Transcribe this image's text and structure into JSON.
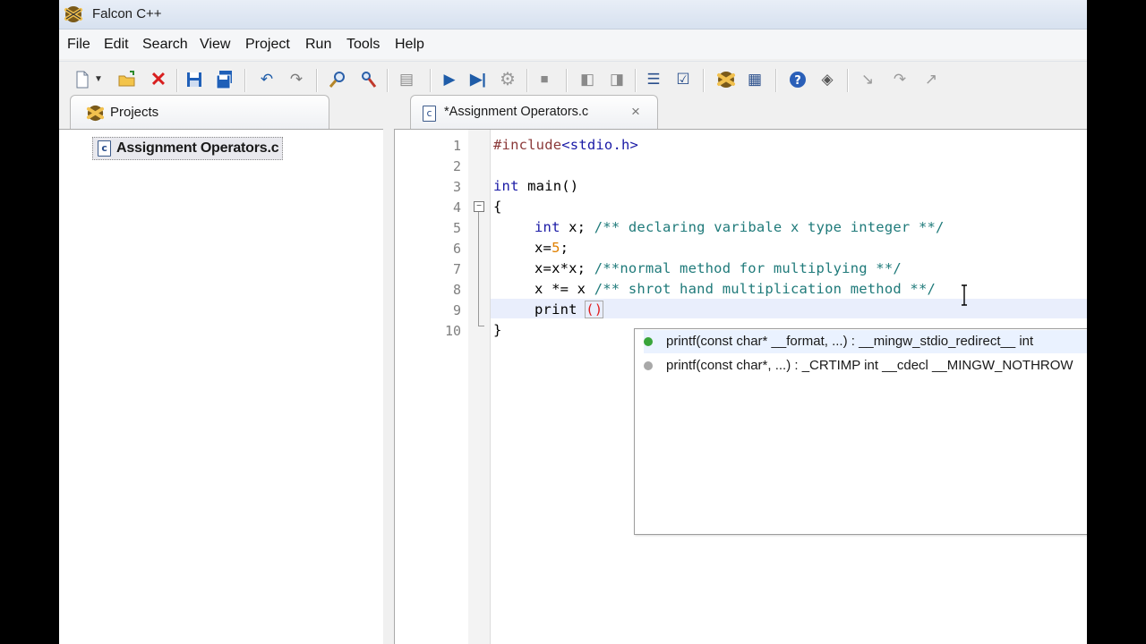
{
  "window": {
    "title": "Falcon C++"
  },
  "menu": [
    "File",
    "Edit",
    "Search",
    "View",
    "Project",
    "Run",
    "Tools",
    "Help"
  ],
  "toolbar": {
    "icons": [
      "new-file-icon",
      "dropdown-arrow-icon",
      "open-folder-icon",
      "close-icon",
      "save-icon",
      "save-all-icon",
      "undo-icon",
      "redo-icon",
      "find-icon",
      "replace-icon",
      "print-icon",
      "run-icon",
      "step-run-icon",
      "build-icon",
      "stop-icon",
      "indent-left-icon",
      "indent-right-icon",
      "list-icon",
      "checkbox-icon",
      "falcon-icon",
      "properties-icon",
      "help-icon",
      "book-icon",
      "step-into-icon",
      "step-over-icon",
      "step-out-icon"
    ]
  },
  "projects_panel": {
    "tab_label": "Projects",
    "items": [
      {
        "label": "Assignment Operators.c"
      }
    ]
  },
  "editor": {
    "tab_label": "*Assignment Operators.c",
    "close_glyph": "×",
    "line_numbers": [
      "1",
      "2",
      "3",
      "4",
      "5",
      "6",
      "7",
      "8",
      "9",
      "10"
    ],
    "lines": {
      "l1_directive": "#include",
      "l1_header": "<stdio.h>",
      "l3_type": "int",
      "l3_rest": " main()",
      "l4": "{",
      "l5_type": "int",
      "l5_var": " x; ",
      "l5_comment": "/** declaring varibale x type integer **/",
      "l6_a": "x=",
      "l6_num": "5",
      "l6_b": ";",
      "l7_code": "x=x*x; ",
      "l7_comment": "/**normal method for multiplying **/",
      "l8_code": "x *= x ",
      "l8_comment": "/** shrot hand multiplication method **/",
      "l9_code": "print ",
      "l9_paren": "()",
      "l10": "}"
    }
  },
  "autocomplete": {
    "items": [
      {
        "text": "printf(const char* __format, ...) : __mingw_stdio_redirect__ int",
        "dot_color": "#3aa53a",
        "selected": true
      },
      {
        "text": "printf(const char*, ...) : _CRTIMP int __cdecl __MINGW_NOTHROW",
        "dot_color": "#a8a8a8",
        "selected": false
      }
    ]
  },
  "colors": {
    "keyword": "#1a1aa6",
    "comment": "#1f7a7a",
    "number": "#e08000",
    "directive": "#8b3a3a",
    "brace_match": "#e02020"
  }
}
